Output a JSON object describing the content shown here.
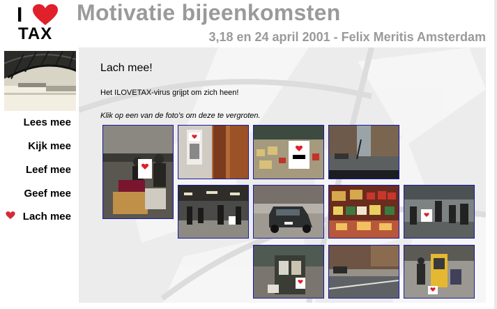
{
  "header": {
    "title": "Motivatie bijeenkomsten",
    "subtitle": "3,18 en 24 april 2001 - Felix Meritis Amsterdam"
  },
  "logo": {
    "letter": "I",
    "word": "TAX",
    "heart_color": "#e0202a"
  },
  "nav": {
    "items": [
      {
        "label": "Lees mee",
        "active": false
      },
      {
        "label": "Kijk mee",
        "active": false
      },
      {
        "label": "Leef mee",
        "active": false
      },
      {
        "label": "Geef mee",
        "active": false
      },
      {
        "label": "Lach mee",
        "active": true
      }
    ]
  },
  "content": {
    "title": "Lach mee!",
    "text": "Het ILOVETAX-virus grijpt om zich heen!",
    "instruction": "Klik op een van de foto's om deze te vergroten."
  },
  "thumbnails": [
    {
      "subject": "people at station with luggage cart and I love TAX sign",
      "tall": true
    },
    {
      "subject": "I love TAX sticker on wooden door panel"
    },
    {
      "subject": "I love TAX bag in front of shop display"
    },
    {
      "subject": "street view from car"
    },
    {
      "subject": "station hall with I love TAX sign"
    },
    {
      "subject": "dark car parked on sidewalk"
    },
    {
      "subject": "shop window with colorful products"
    },
    {
      "subject": "station platform with people and I love TAX sign"
    },
    {
      "subject": "newspaper kiosk with I love TAX sign"
    },
    {
      "subject": "street corner"
    },
    {
      "subject": "ticket machine with I love TAX sign"
    }
  ],
  "colors": {
    "title_gray": "#9a9a9a",
    "thumb_border": "#1a1aa0",
    "panel_bg": "#eeeeee"
  }
}
